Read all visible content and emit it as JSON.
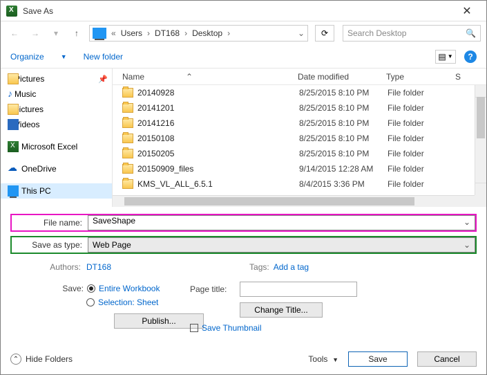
{
  "window": {
    "title": "Save As"
  },
  "nav": {
    "breadcrumb": [
      "Users",
      "DT168",
      "Desktop"
    ],
    "search_placeholder": "Search Desktop"
  },
  "toolbar": {
    "organize": "Organize",
    "new_folder": "New folder"
  },
  "sidebar": {
    "items": [
      {
        "label": "Pictures",
        "pinned": true
      },
      {
        "label": "Music"
      },
      {
        "label": "pictures"
      },
      {
        "label": "Videos"
      },
      {
        "label": "Microsoft Excel"
      },
      {
        "label": "OneDrive"
      },
      {
        "label": "This PC"
      }
    ]
  },
  "columns": {
    "name": "Name",
    "date": "Date modified",
    "type": "Type",
    "size": "S"
  },
  "files": [
    {
      "name": "20140928",
      "date": "8/25/2015 8:10 PM",
      "type": "File folder"
    },
    {
      "name": "20141201",
      "date": "8/25/2015 8:10 PM",
      "type": "File folder"
    },
    {
      "name": "20141216",
      "date": "8/25/2015 8:10 PM",
      "type": "File folder"
    },
    {
      "name": "20150108",
      "date": "8/25/2015 8:10 PM",
      "type": "File folder"
    },
    {
      "name": "20150205",
      "date": "8/25/2015 8:10 PM",
      "type": "File folder"
    },
    {
      "name": "20150909_files",
      "date": "9/14/2015 12:28 AM",
      "type": "File folder"
    },
    {
      "name": "KMS_VL_ALL_6.5.1",
      "date": "8/4/2015 3:36 PM",
      "type": "File folder"
    }
  ],
  "form": {
    "filename_label": "File name:",
    "filename_value": "SaveShape",
    "type_label": "Save as type:",
    "type_value": "Web Page",
    "authors_label": "Authors:",
    "authors_value": "DT168",
    "tags_label": "Tags:",
    "tags_value": "Add a tag",
    "save_label": "Save:",
    "save_opt1": "Entire Workbook",
    "save_opt2": "Selection: Sheet",
    "publish": "Publish...",
    "page_title_label": "Page title:",
    "change_title": "Change Title...",
    "save_thumb": "Save Thumbnail"
  },
  "footer": {
    "hide": "Hide Folders",
    "tools": "Tools",
    "save": "Save",
    "cancel": "Cancel"
  }
}
